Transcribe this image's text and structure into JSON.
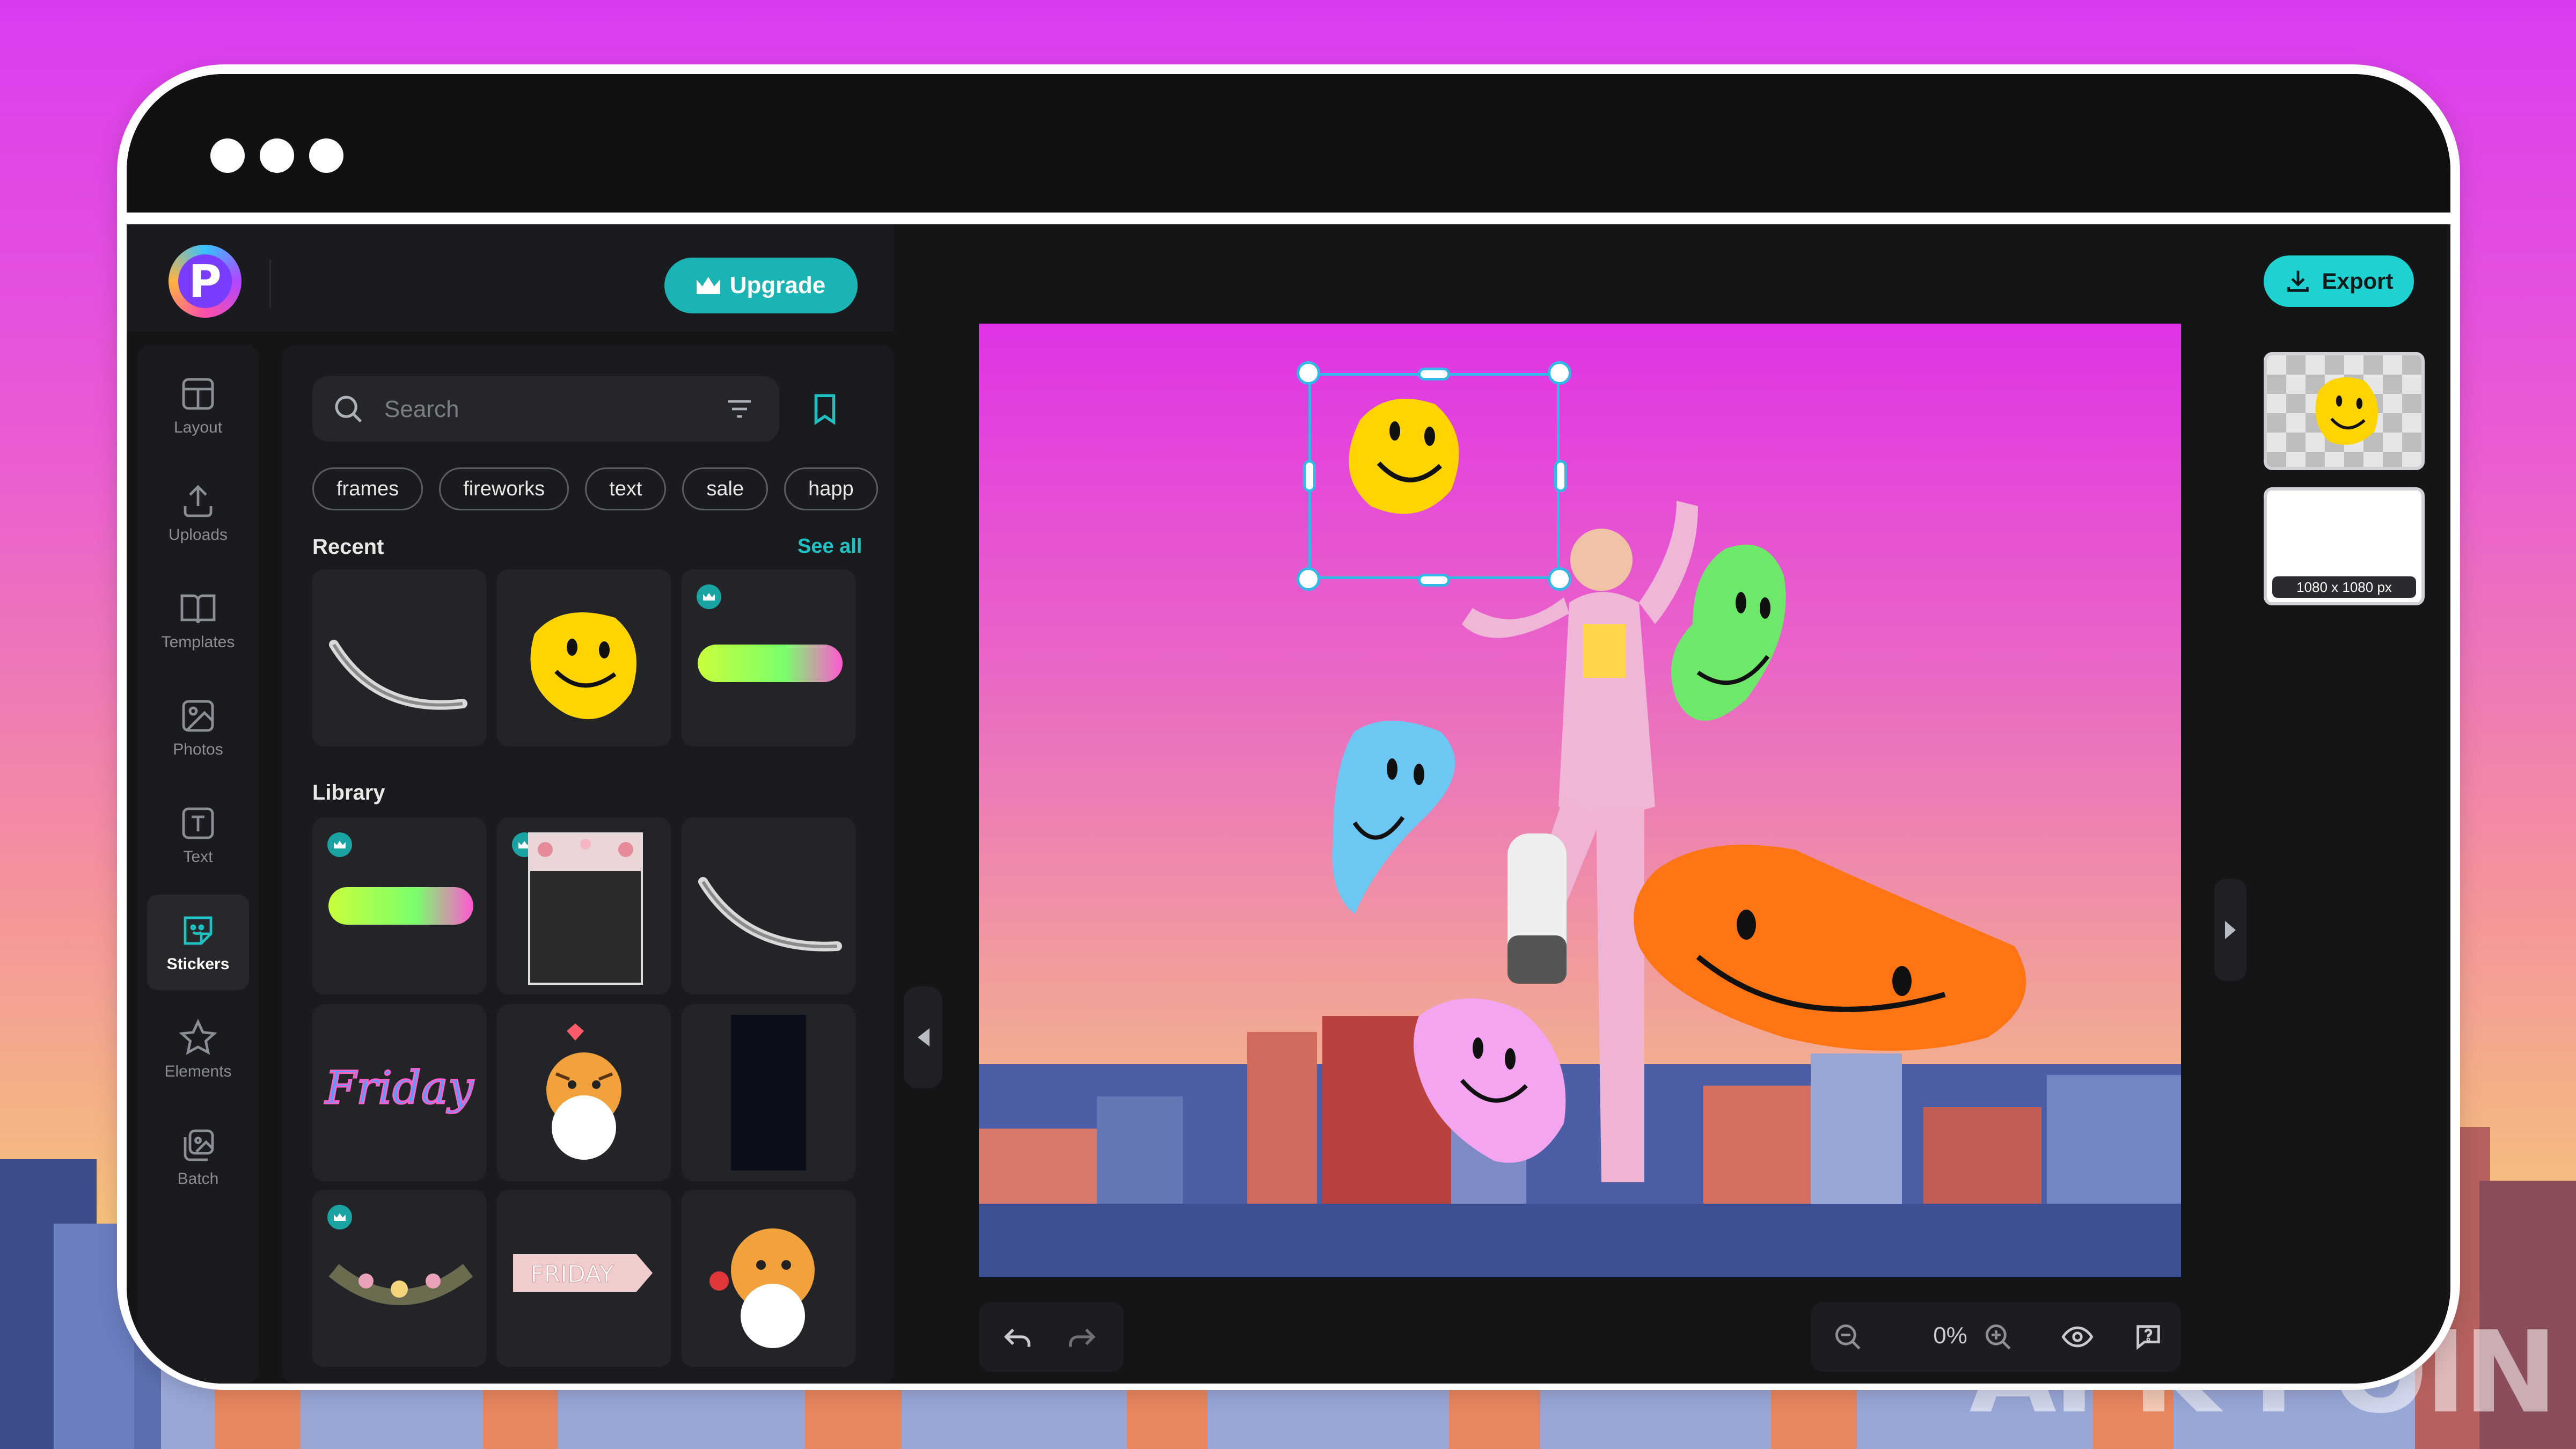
{
  "app": {
    "logo_letter": "P"
  },
  "header": {
    "upgrade_label": "Upgrade",
    "export_label": "Export"
  },
  "rail": {
    "items": [
      {
        "label": "Layout",
        "icon": "layout-icon"
      },
      {
        "label": "Uploads",
        "icon": "upload-icon"
      },
      {
        "label": "Templates",
        "icon": "book-icon"
      },
      {
        "label": "Photos",
        "icon": "image-icon"
      },
      {
        "label": "Text",
        "icon": "text-icon"
      },
      {
        "label": "Stickers",
        "icon": "sticker-icon",
        "active": true
      },
      {
        "label": "Elements",
        "icon": "star-icon"
      },
      {
        "label": "Batch",
        "icon": "batch-icon"
      }
    ]
  },
  "panel": {
    "search_placeholder": "Search",
    "chips": [
      "frames",
      "fireworks",
      "text",
      "sale",
      "happ"
    ],
    "recent_title": "Recent",
    "see_all": "See all",
    "library_title": "Library",
    "friday_sticker_text": "Friday",
    "friday_banner_text": "FRIDAY"
  },
  "bottom": {
    "zoom": "0%"
  },
  "right": {
    "size_label": "1080 x 1080 px"
  },
  "watermark": "APK POIN",
  "colors": {
    "accent": "#1ab4b4",
    "export": "#1fd2d2",
    "selection": "#32b9e6",
    "panel": "#1a1b1e"
  }
}
